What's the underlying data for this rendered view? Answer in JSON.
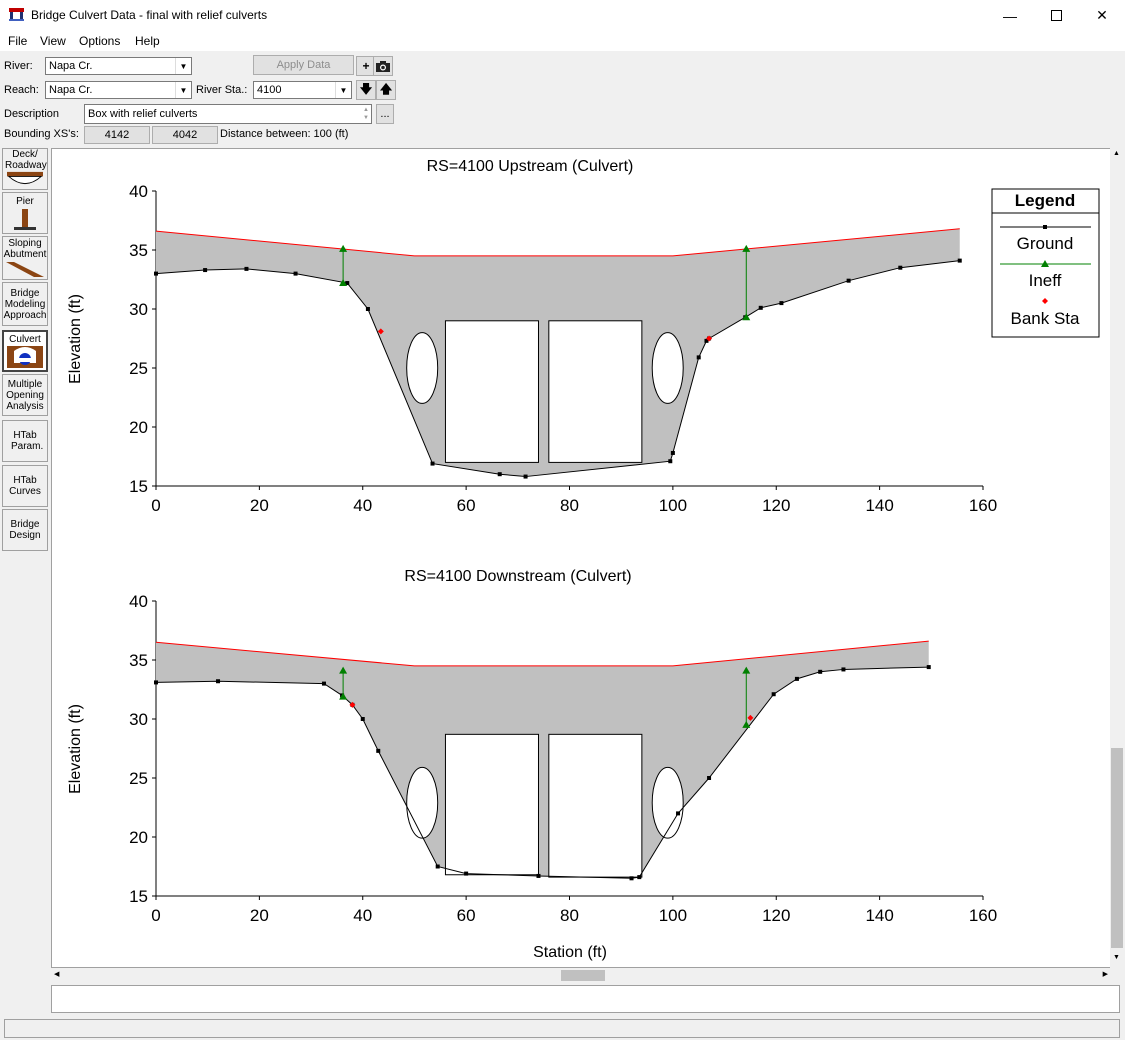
{
  "window": {
    "title": "Bridge Culvert Data - final with relief culverts"
  },
  "menu": {
    "file": "File",
    "view": "View",
    "options": "Options",
    "help": "Help"
  },
  "form": {
    "river_label": "River:",
    "river_value": "Napa Cr.",
    "reach_label": "Reach:",
    "reach_value": "Napa Cr.",
    "river_sta_label": "River Sta.:",
    "river_sta_value": "4100",
    "apply_data": "Apply Data",
    "description_label": "Description",
    "description_value": "Box with relief culverts",
    "more_button": "...",
    "bounding_label": "Bounding XS's:",
    "bounding_us": "4142",
    "bounding_ds": "4042",
    "distance_text": "Distance between: 100 (ft)"
  },
  "sidebar": {
    "items": [
      {
        "label": "Deck/ Roadway",
        "icon": "deck-roadway-icon"
      },
      {
        "label": "Pier",
        "icon": "pier-icon"
      },
      {
        "label": "Sloping Abutment",
        "icon": "sloping-abutment-icon"
      },
      {
        "label": "Bridge Modeling Approach",
        "icon": ""
      },
      {
        "label": "Culvert",
        "icon": "culvert-icon"
      },
      {
        "label": "Multiple Opening Analysis",
        "icon": ""
      },
      {
        "label": "HTab Param.",
        "icon": ""
      },
      {
        "label": "HTab Curves",
        "icon": ""
      },
      {
        "label": "Bridge Design",
        "icon": ""
      }
    ]
  },
  "colors": {
    "ground": "#000000",
    "ineff": "#008000",
    "bank": "#ff0000",
    "deck_line": "#ff0000",
    "fill": "#c0c0c0"
  },
  "chart_data": [
    {
      "type": "line",
      "title": "RS=4100    Upstream  (Culvert)",
      "xlabel": "",
      "ylabel": "Elevation (ft)",
      "xlim": [
        0,
        160
      ],
      "ylim": [
        15,
        40
      ],
      "xticks": [
        0,
        20,
        40,
        60,
        80,
        100,
        120,
        140,
        160
      ],
      "yticks": [
        15,
        20,
        25,
        30,
        35,
        40
      ],
      "legend": {
        "title": "Legend",
        "placement": "top-right",
        "entries": [
          "Ground",
          "Ineff",
          "Bank Sta"
        ]
      },
      "ground": [
        [
          0,
          33
        ],
        [
          9.5,
          33.3
        ],
        [
          17.5,
          33.4
        ],
        [
          27,
          33
        ],
        [
          37,
          32.2
        ],
        [
          41,
          30
        ],
        [
          53.5,
          16.9
        ],
        [
          66.5,
          16
        ],
        [
          71.5,
          15.8
        ],
        [
          99.5,
          17.1
        ],
        [
          100,
          17.8
        ],
        [
          105,
          25.9
        ],
        [
          106.5,
          27.3
        ],
        [
          107,
          27.5
        ],
        [
          114,
          29.3
        ],
        [
          117,
          30.1
        ],
        [
          121,
          30.5
        ],
        [
          134,
          32.4
        ],
        [
          144,
          33.5
        ],
        [
          155.5,
          34.1
        ]
      ],
      "deck": [
        [
          0,
          36.6
        ],
        [
          50,
          34.5
        ],
        [
          100,
          34.5
        ],
        [
          155.5,
          36.8
        ]
      ],
      "ineff": [
        {
          "x": 36.2,
          "low": 32.2,
          "high": 35.1
        },
        {
          "x": 114.2,
          "low": 29.3,
          "high": 35.1
        }
      ],
      "bank_sta": [
        [
          43.5,
          28.1
        ],
        [
          107,
          27.5
        ]
      ],
      "boxes": [
        {
          "x1": 56,
          "x2": 74,
          "y1": 17,
          "y2": 29
        },
        {
          "x1": 76,
          "x2": 94,
          "y1": 17,
          "y2": 29
        }
      ],
      "circles": [
        {
          "cx": 51.5,
          "cy": 25,
          "rx": 3,
          "ry": 3
        },
        {
          "cx": 99,
          "cy": 25,
          "rx": 3,
          "ry": 3
        }
      ]
    },
    {
      "type": "line",
      "title": "RS=4100    Downstream  (Culvert)",
      "xlabel": "Station (ft)",
      "ylabel": "Elevation (ft)",
      "xlim": [
        0,
        160
      ],
      "ylim": [
        15,
        40
      ],
      "xticks": [
        0,
        20,
        40,
        60,
        80,
        100,
        120,
        140,
        160
      ],
      "yticks": [
        15,
        20,
        25,
        30,
        35,
        40
      ],
      "ground": [
        [
          0,
          33.1
        ],
        [
          12,
          33.2
        ],
        [
          32.5,
          33
        ],
        [
          36,
          32
        ],
        [
          38,
          31.2
        ],
        [
          40,
          30
        ],
        [
          43,
          27.3
        ],
        [
          54.5,
          17.5
        ],
        [
          60,
          16.9
        ],
        [
          74,
          16.7
        ],
        [
          92,
          16.5
        ],
        [
          93.5,
          16.6
        ],
        [
          101,
          22
        ],
        [
          107,
          25
        ],
        [
          119.5,
          32.1
        ],
        [
          124,
          33.4
        ],
        [
          128.5,
          34
        ],
        [
          133,
          34.2
        ],
        [
          149.5,
          34.4
        ]
      ],
      "deck": [
        [
          0,
          36.5
        ],
        [
          50,
          34.5
        ],
        [
          100,
          34.5
        ],
        [
          149.5,
          36.6
        ]
      ],
      "ineff": [
        {
          "x": 36.2,
          "low": 31.9,
          "high": 34.1
        },
        {
          "x": 114.2,
          "low": 29.5,
          "high": 34.1
        }
      ],
      "bank_sta": [
        [
          38,
          31.2
        ],
        [
          115,
          30.1
        ]
      ],
      "boxes": [
        {
          "x1": 56,
          "x2": 74,
          "y1": 16.8,
          "y2": 28.7
        },
        {
          "x1": 76,
          "x2": 94,
          "y1": 16.6,
          "y2": 28.7
        }
      ],
      "circles": [
        {
          "cx": 51.5,
          "cy": 22.9,
          "rx": 3,
          "ry": 3
        },
        {
          "cx": 99,
          "cy": 22.9,
          "rx": 3,
          "ry": 3
        }
      ]
    }
  ]
}
